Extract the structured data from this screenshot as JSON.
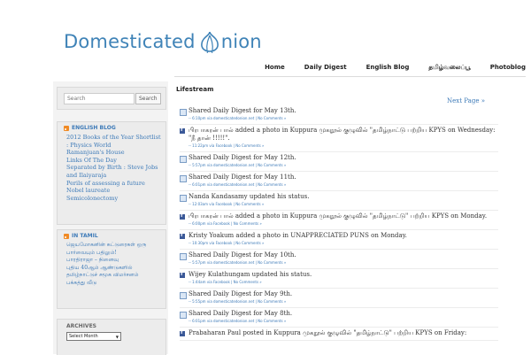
{
  "header": {
    "logo_part1": "Domesticated",
    "logo_part2": "nion",
    "nav": [
      "Home",
      "Daily Digest",
      "English Blog",
      "தமிழ்வலைப்பூ",
      "Photoblog"
    ]
  },
  "sidebar": {
    "search": {
      "placeholder": "Search",
      "button": "Search"
    },
    "english_blog": {
      "title": "ENGLISH BLOG",
      "links": [
        "2012 Books of the Year Shortlist",
        ": Physics World",
        "Ramanjuan's House",
        "Links Of The Day",
        "Separated by Birth : Steve Jobs",
        "and Ilaiyaraja",
        "Perils of assessing a future",
        "Nobel laureate",
        "Semicolonectomy"
      ]
    },
    "tamil": {
      "title": "IN TAMIL",
      "links": [
        "ஜெயமோகனின் கட்டுரைகள் ஒரு",
        "பார்வையும் பதிலும்!",
        "பாரதிராஜா – நினைவு",
        "புதிய 40ஆம் ஆண்டுகளில்",
        "தமிழ்நாட்டுச் சமூக விமர்சனம்",
        "பக்கத்து வீடு"
      ]
    },
    "archives": {
      "title": "ARCHIVES",
      "select": "Select Month"
    }
  },
  "main": {
    "title": "Lifestream",
    "next_page": "Next Page »",
    "entries": [
      {
        "icon": "doc",
        "text": "Shared Daily Digest for May 13th.",
        "meta": "-- 6:10pm via domesticatedonion.net | No Comments »"
      },
      {
        "icon": "fb",
        "text": "பிரபாகரன் பால் added a photo in Kuppura முகநூல் குழுவில் \"தமிழ்நாட்டு பற்றிய KPYS on Wednesday:",
        "text2": "\"நீ தான் !!!!!\".",
        "meta": "-- 11:22pm via Facebook | No Comments »"
      },
      {
        "icon": "doc",
        "text": "Shared Daily Digest for May 12th.",
        "meta": "-- 5:57pm via domesticatedonion.net | No Comments »"
      },
      {
        "icon": "doc",
        "text": "Shared Daily Digest for May 11th.",
        "meta": "-- 6:01pm via domesticatedonion.net | No Comments »"
      },
      {
        "icon": "doc",
        "text": "Nanda Kandasamy updated his status.",
        "meta": "-- 12:03am via Facebook | No Comments »"
      },
      {
        "icon": "fb",
        "text": "பிரபாகரன் பால் added a photo in Kuppura முகநூல் குழுவில் \"தமிழ்நாட்டு\" பற்றிய KPYS on Monday.",
        "meta": "-- 6:00pm via Facebook | No Comments »"
      },
      {
        "icon": "fb",
        "text": "Kristy Yoakum added a photo in UNAPPRECIATED PUNS on Monday.",
        "meta": "-- 10:30pm via Facebook | No Comments »"
      },
      {
        "icon": "doc",
        "text": "Shared Daily Digest for May 10th.",
        "meta": "-- 5:57pm via domesticatedonion.net | No Comments »"
      },
      {
        "icon": "fb",
        "text": "Wijey Kulathungam updated his status.",
        "meta": "-- 1:44am via Facebook | No Comments »"
      },
      {
        "icon": "doc",
        "text": "Shared Daily Digest for May 9th.",
        "meta": "-- 5:55pm via domesticatedonion.net | No Comments »"
      },
      {
        "icon": "doc",
        "text": "Shared Daily Digest for May 8th.",
        "meta": "-- 6:01pm via domesticatedonion.net | No Comments »"
      },
      {
        "icon": "fb",
        "text": "Prabaharan Paul posted in Kuppura முகநூல் குழுவில் \"தமிழ்நாட்டு\" பற்றிய KPYS on Friday:",
        "meta": ""
      }
    ]
  }
}
